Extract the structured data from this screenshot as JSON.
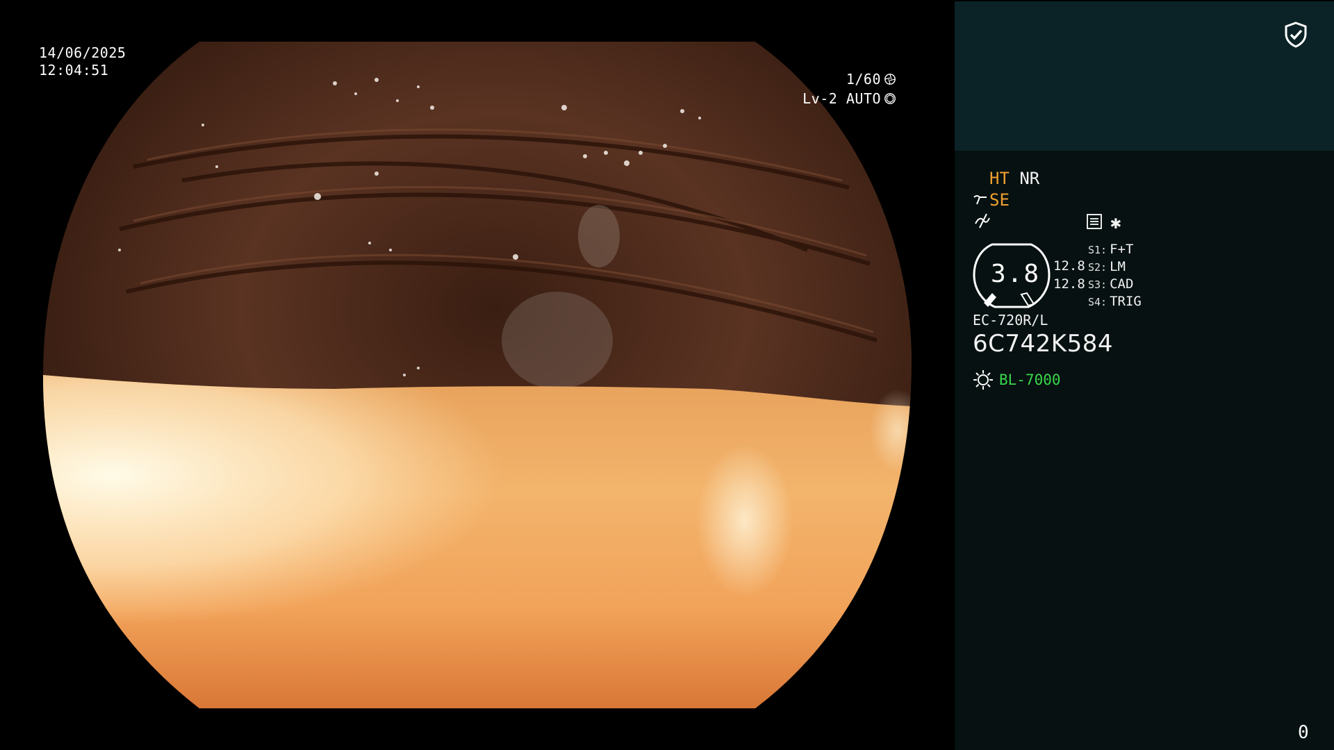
{
  "overlay": {
    "date": "14/06/2025",
    "time": "12:04:51",
    "shutter": "1/60",
    "level": "Lv-2 AUTO"
  },
  "panel": {
    "ht": "HT",
    "nr": "NR",
    "se": "SE",
    "gauge_value": "3.8",
    "gauge_r1": "12.8",
    "gauge_r2": "12.8",
    "switches": [
      {
        "key": "S1:",
        "value": "F+T"
      },
      {
        "key": "S2:",
        "value": "LM"
      },
      {
        "key": "S3:",
        "value": "CAD"
      },
      {
        "key": "S4:",
        "value": "TRIG"
      }
    ],
    "model": "EC-720R/L",
    "serial": "6C742K584",
    "light_source": "BL-7000",
    "counter": "0",
    "colors": {
      "panel_top": "#0b2326",
      "panel_bottom": "#071111",
      "accent_orange": "#f0a030",
      "accent_green": "#38d84a"
    },
    "icons": [
      "shield-check-icon",
      "shutter-icon",
      "iris-icon",
      "curve-icon",
      "no-signal-icon",
      "menu-icon",
      "asterisk-icon",
      "sun-icon"
    ]
  }
}
